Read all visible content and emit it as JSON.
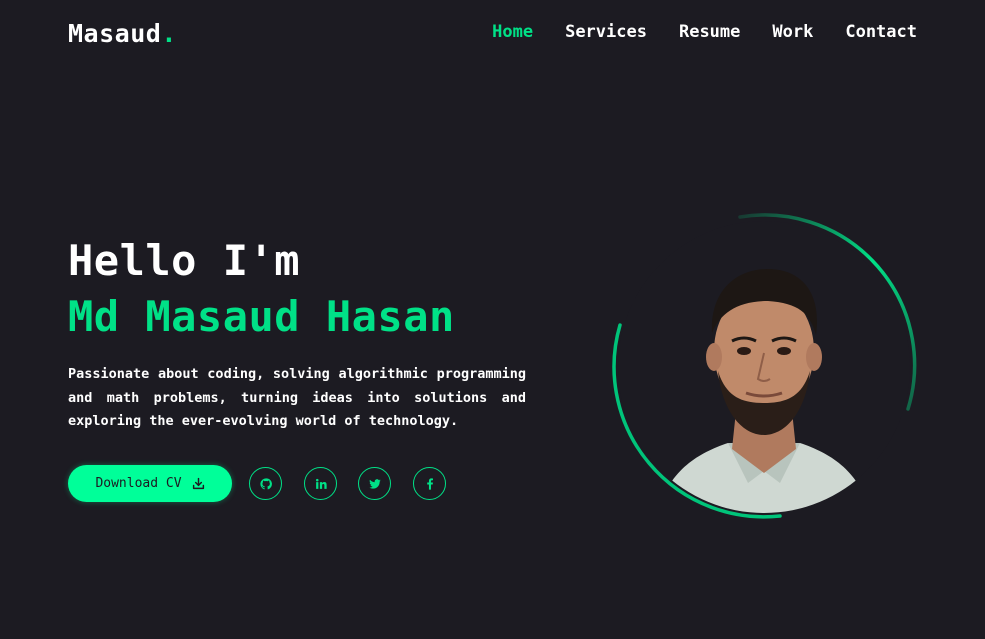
{
  "header": {
    "logo_text": "Masaud",
    "logo_dot": ".",
    "nav": [
      {
        "label": "Home",
        "active": true
      },
      {
        "label": "Services",
        "active": false
      },
      {
        "label": "Resume",
        "active": false
      },
      {
        "label": "Work",
        "active": false
      },
      {
        "label": "Contact",
        "active": false
      }
    ]
  },
  "hero": {
    "greeting": "Hello I'm",
    "name": "Md Masaud Hasan",
    "description": "Passionate about coding, solving algorithmic programming and math problems, turning ideas into solutions and exploring the ever-evolving world of technology.",
    "download_label": "Download CV",
    "download_icon": "download-icon",
    "socials": [
      {
        "icon": "github-icon"
      },
      {
        "icon": "linkedin-icon"
      },
      {
        "icon": "twitter-icon"
      },
      {
        "icon": "facebook-icon"
      }
    ]
  },
  "colors": {
    "background": "#1c1b22",
    "accent": "#00e187",
    "button": "#00ff99",
    "text": "#ffffff"
  }
}
